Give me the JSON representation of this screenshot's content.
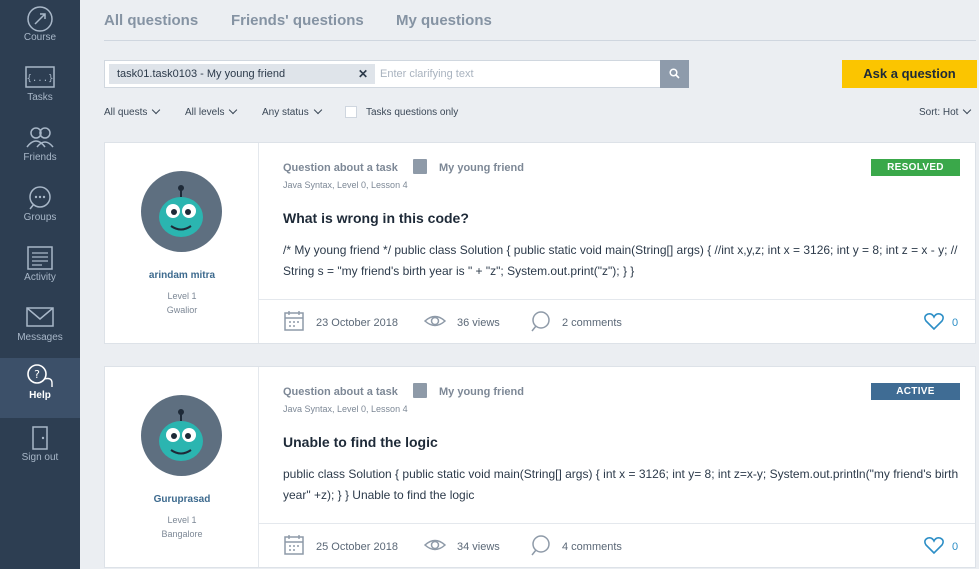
{
  "sidebar": {
    "items": [
      {
        "label": "Course",
        "icon": "rocket-icon"
      },
      {
        "label": "Tasks",
        "icon": "code-icon"
      },
      {
        "label": "Friends",
        "icon": "friends-icon"
      },
      {
        "label": "Groups",
        "icon": "groups-icon"
      },
      {
        "label": "Activity",
        "icon": "activity-icon"
      },
      {
        "label": "Messages",
        "icon": "envelope-icon"
      },
      {
        "label": "Help",
        "icon": "help-icon",
        "active": true
      },
      {
        "label": "Sign out",
        "icon": "door-icon"
      }
    ]
  },
  "tabs": [
    "All questions",
    "Friends' questions",
    "My questions"
  ],
  "search": {
    "chip": "task01.task0103 - My young friend",
    "chip_close": "✕",
    "placeholder": "Enter clarifying text"
  },
  "ask_button": "Ask a question",
  "filters": {
    "quests": "All quests",
    "levels": "All levels",
    "status": "Any status",
    "tasks_only": "Tasks questions only",
    "sort": "Sort:  Hot"
  },
  "questions": [
    {
      "author": "arindam mitra",
      "level": "Level 1",
      "city": "Gwalior",
      "type": "Question about a task",
      "task": "My young friend",
      "path": "Java Syntax, Level 0, Lesson 4",
      "status": "RESOLVED",
      "status_color": "#3aa84a",
      "title": "What is wrong in this code?",
      "body": "/* My young friend */ public class Solution { public static void main(String[] args) { //int x,y,z; int x = 3126; int y = 8; int z = x - y; // String s = \"my friend's birth year is \" + \"z\"; System.out.print(\"z\"); } }",
      "date": "23 October 2018",
      "views": "36  views",
      "comments": "2  comments",
      "likes": "0"
    },
    {
      "author": "Guruprasad",
      "level": "Level 1",
      "city": "Bangalore",
      "type": "Question about a task",
      "task": "My young friend",
      "path": "Java Syntax, Level 0, Lesson 4",
      "status": "ACTIVE",
      "status_color": "#3f6c94",
      "title": "Unable to find the logic",
      "body": "public class Solution { public static void main(String[] args) { int x = 3126; int y= 8; int z=x-y; System.out.println(\"my friend's birth year\" +z); } } Unable to find the logic",
      "date": "25 October 2018",
      "views": "34  views",
      "comments": "4  comments",
      "likes": "0"
    }
  ]
}
